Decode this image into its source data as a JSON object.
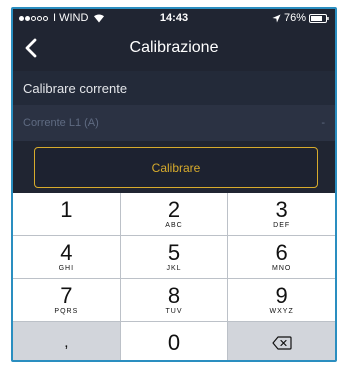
{
  "status_bar": {
    "carrier": "I WIND",
    "time": "14:43",
    "battery": "76%"
  },
  "nav": {
    "title": "Calibrazione"
  },
  "section": {
    "header": "Calibrare corrente"
  },
  "field": {
    "label": "Corrente L1 (A)",
    "value": "-"
  },
  "actions": {
    "calibrate_label": "Calibrare"
  },
  "keypad": {
    "keys": [
      {
        "digit": "1",
        "letters": ""
      },
      {
        "digit": "2",
        "letters": "ABC"
      },
      {
        "digit": "3",
        "letters": "DEF"
      },
      {
        "digit": "4",
        "letters": "GHI"
      },
      {
        "digit": "5",
        "letters": "JKL"
      },
      {
        "digit": "6",
        "letters": "MNO"
      },
      {
        "digit": "7",
        "letters": "PQRS"
      },
      {
        "digit": "8",
        "letters": "TUV"
      },
      {
        "digit": "9",
        "letters": "WXYZ"
      },
      {
        "digit": ",",
        "letters": ""
      },
      {
        "digit": "0",
        "letters": ""
      },
      {
        "digit": "",
        "letters": ""
      }
    ]
  },
  "colors": {
    "background": "#202532",
    "accent": "#d7ab2c",
    "frame_border": "#2a8ec0"
  },
  "icons": {
    "back": "chevron-left-icon",
    "wifi": "wifi-icon",
    "location": "location-arrow-icon",
    "battery": "battery-icon",
    "delete": "backspace-icon"
  }
}
